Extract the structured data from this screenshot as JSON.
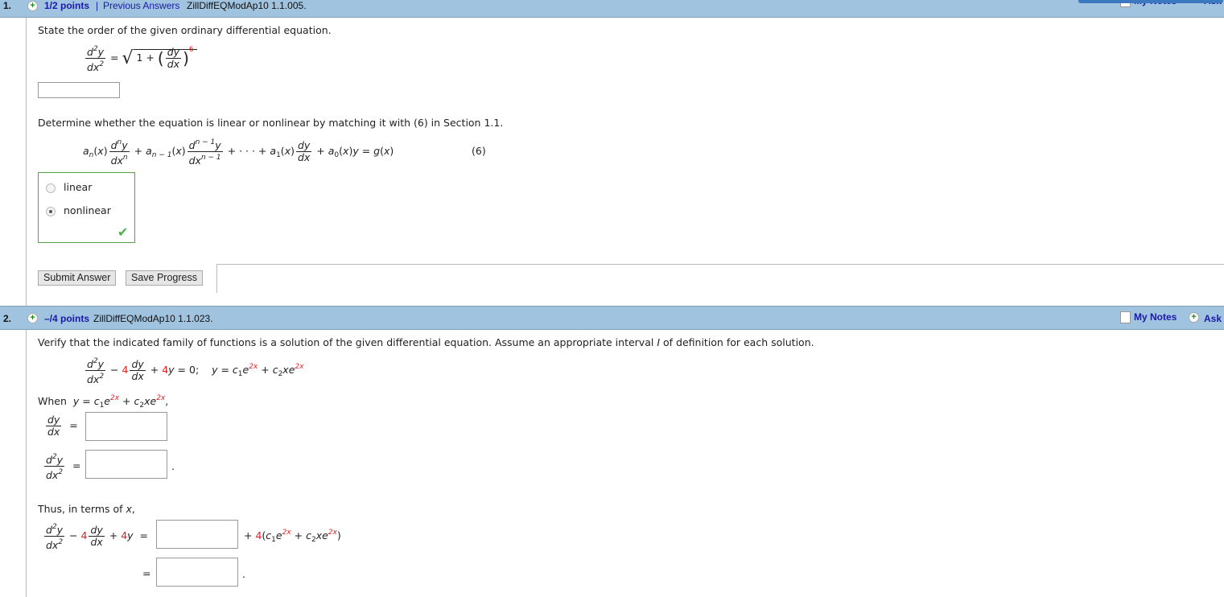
{
  "q1": {
    "number": "1.",
    "points": "1/2 points",
    "separator": "|",
    "prev_answers": "Previous Answers",
    "code": "ZillDiffEQModAp10 1.1.005.",
    "my_notes": "My Notes",
    "ask": "Ask",
    "prompt": "State the order of the given ordinary differential equation.",
    "order_answer": "",
    "prompt2": "Determine whether the equation is linear or nonlinear by matching it with (6) in Section 1.1.",
    "eq_label": "(6)",
    "options": [
      {
        "label": "linear",
        "selected": false
      },
      {
        "label": "nonlinear",
        "selected": true
      }
    ],
    "submit": "Submit Answer",
    "save": "Save Progress"
  },
  "q2": {
    "number": "2.",
    "points": "–/4 points",
    "code": "ZillDiffEQModAp10 1.1.023.",
    "my_notes": "My Notes",
    "ask": "Ask",
    "prompt": "Verify that the indicated family of functions is a solution of the given differential equation. Assume an appropriate interval",
    "prompt_var": "I",
    "prompt_end": "of definition for each solution.",
    "when": "When",
    "thus": "Thus, in terms of",
    "answers": [
      "",
      "",
      "",
      ""
    ]
  },
  "colors": {
    "header": "#a0c3df",
    "link": "#1a1aa8",
    "highlight": "#e02020",
    "correct": "#4caf50"
  }
}
